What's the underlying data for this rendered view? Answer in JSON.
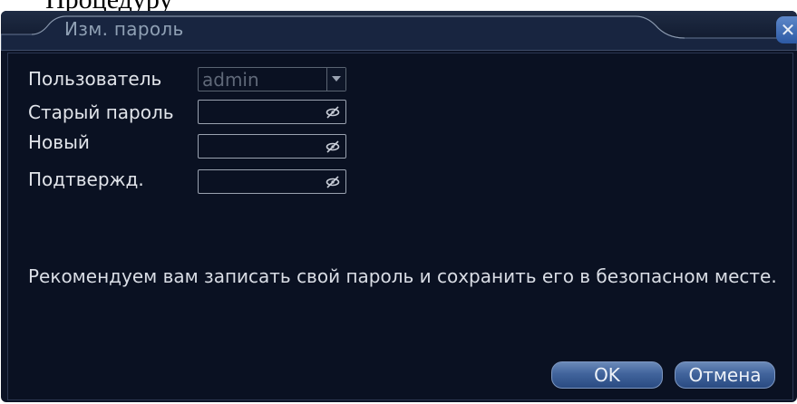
{
  "page_snippet": "Процедуру",
  "dialog": {
    "title": "Изм. пароль",
    "close_glyph": "✕",
    "close_icon": "close-icon"
  },
  "form": {
    "user_label": "Пользователь",
    "user_value": "admin",
    "old_password_label": "Старый пароль",
    "new_password_label": "Новый",
    "confirm_label": "Подтвержд.",
    "old_password_value": "",
    "new_password_value": "",
    "confirm_value": "",
    "eye_icon": "eye-hidden-icon",
    "dropdown_icon": "chevron-down-icon"
  },
  "note": "Рекомендуем вам записать свой пароль и сохранить его в безопасном месте.",
  "buttons": {
    "ok": "OK",
    "cancel": "Отмена"
  },
  "colors": {
    "background": "#0c1325",
    "accent": "#2d5aa5"
  }
}
